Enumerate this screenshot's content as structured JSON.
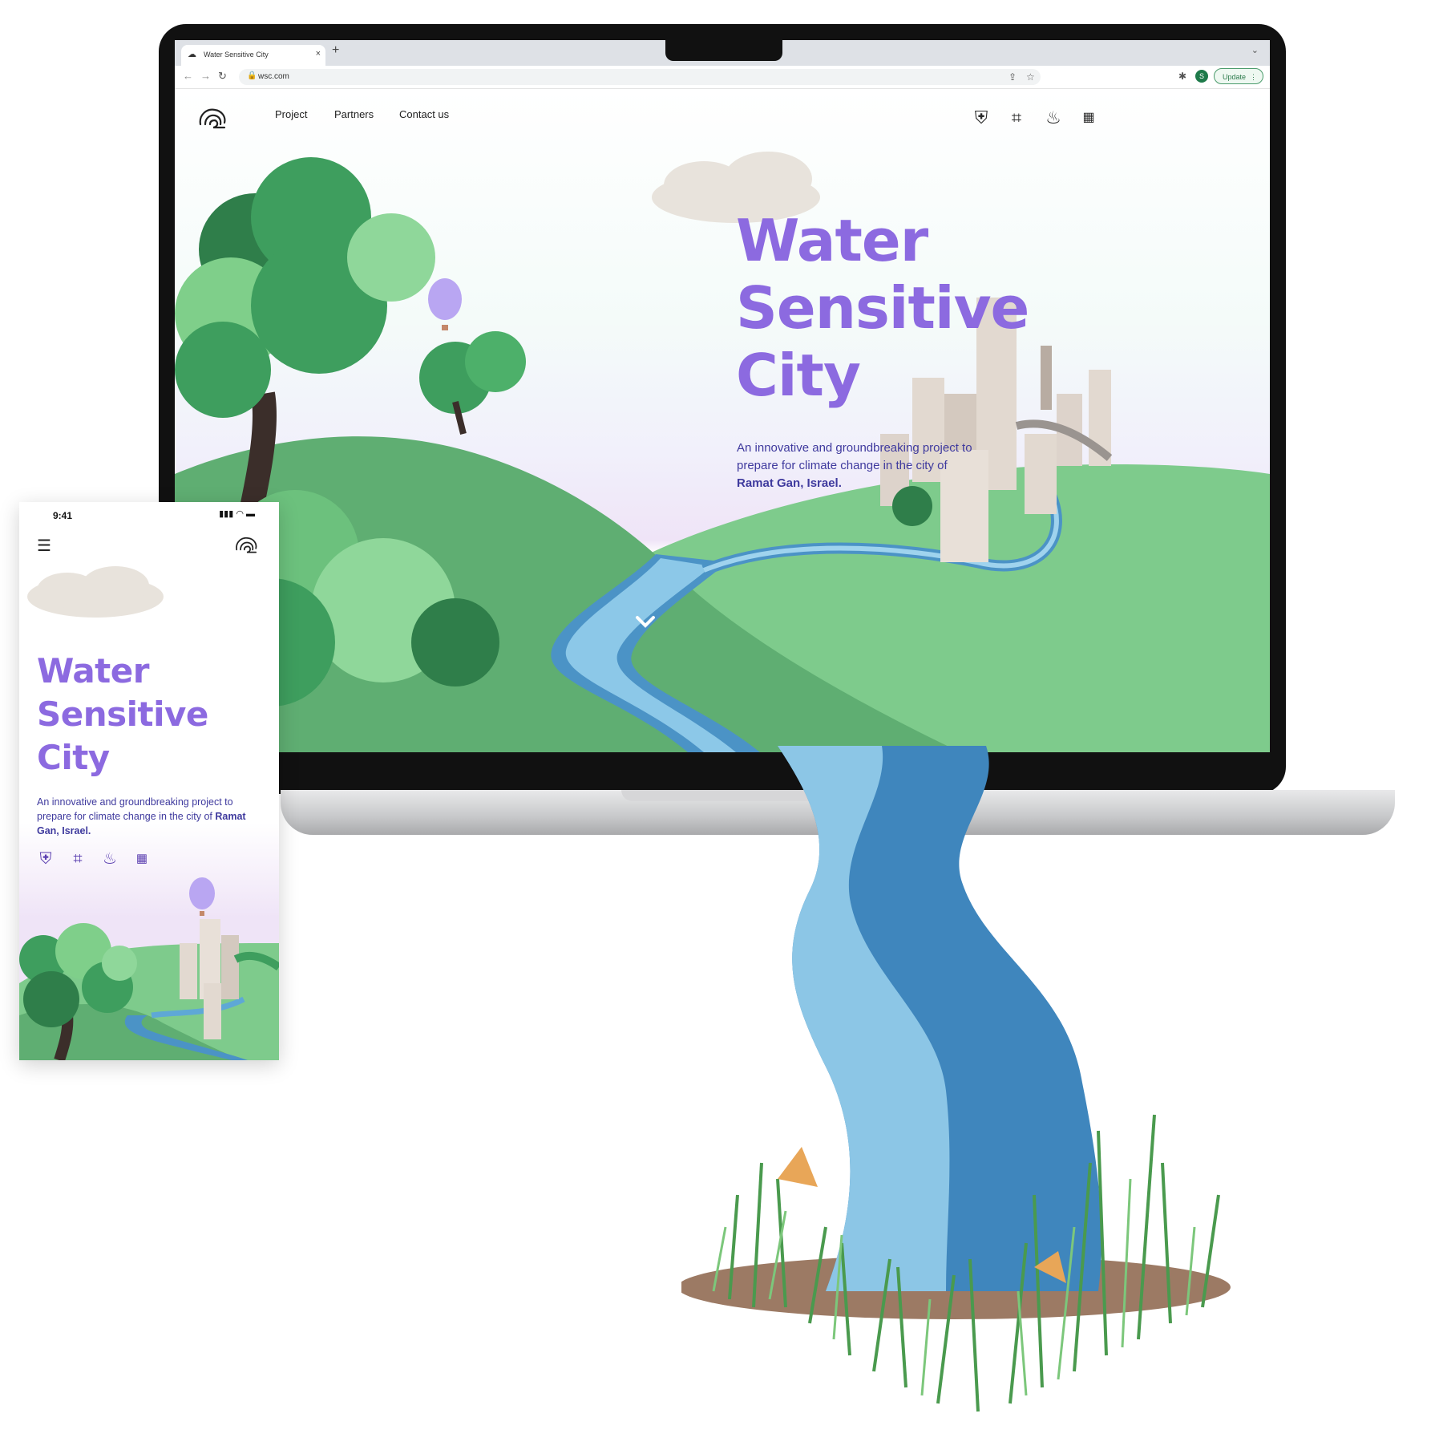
{
  "browser": {
    "tab_title": "Water Sensitive City",
    "tab_close": "×",
    "new_tab": "+",
    "url": "wsc.com",
    "profile_initial": "S",
    "update_label": "Update",
    "update_menu": "⋮"
  },
  "site": {
    "nav": [
      "Project",
      "Partners",
      "Contact us"
    ],
    "title_lines": [
      "Water",
      "Sensitive",
      "City"
    ],
    "subtitle_text": "An innovative and groundbreaking project to prepare for climate change in the city of",
    "subtitle_place": "Ramat Gan, Israel.",
    "partner_icons": [
      "ramat-gan-emblem-icon",
      "grid-knot-partner-icon",
      "droplet-cycle-partner-icon",
      "hebrew-wordmark-partner-icon"
    ],
    "scroll_indicator": "⌄"
  },
  "phone": {
    "time": "9:41",
    "menu_icon": "☰",
    "title_lines": [
      "Water",
      "Sensitive",
      "City"
    ],
    "subtitle_text": "An innovative and groundbreaking project to prepare for climate change in the city of",
    "subtitle_place": "Ramat Gan, Israel."
  },
  "colors": {
    "title_purple": "#8c6ae0",
    "subtitle_indigo": "#3f3a9e",
    "grass_green": "#6bbd7a",
    "river_blue": "#5ea8d6",
    "tree_green": "#3e9e5e"
  }
}
